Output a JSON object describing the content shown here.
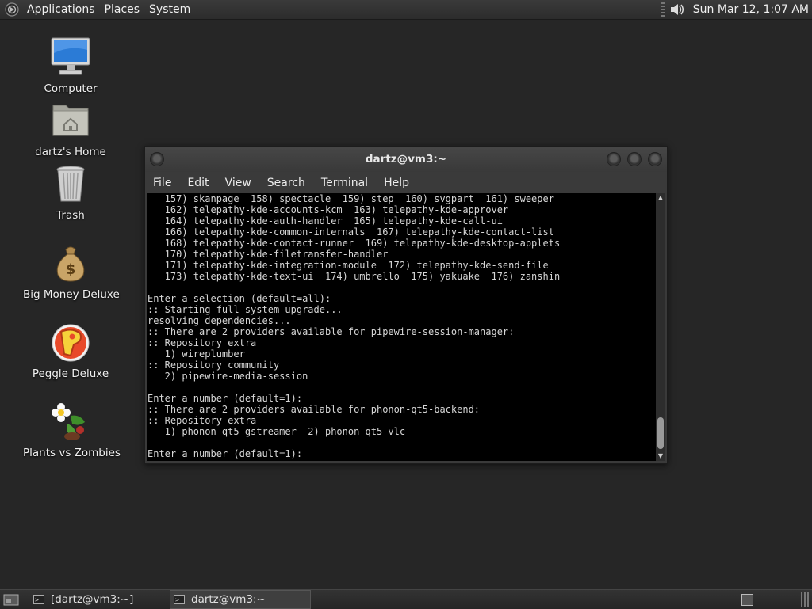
{
  "top_panel": {
    "menus": [
      "Applications",
      "Places",
      "System"
    ],
    "clock": "Sun Mar 12,  1:07 AM",
    "icons": {
      "menu": "distro-logo-icon",
      "volume": "speaker-volume-icon"
    }
  },
  "desktop_icons": [
    {
      "label": "Computer",
      "icon": "computer-monitor-icon"
    },
    {
      "label": "dartz's Home",
      "icon": "home-folder-icon"
    },
    {
      "label": "Trash",
      "icon": "trash-can-icon"
    },
    {
      "label": "Big Money Deluxe",
      "icon": "money-bag-icon"
    },
    {
      "label": "Peggle Deluxe",
      "icon": "peggle-p-icon"
    },
    {
      "label": "Plants vs Zombies",
      "icon": "plants-flower-icon"
    }
  ],
  "terminal_window": {
    "title": "dartz@vm3:~",
    "menus": [
      "File",
      "Edit",
      "View",
      "Search",
      "Terminal",
      "Help"
    ],
    "lines": [
      "   157) skanpage  158) spectacle  159) step  160) svgpart  161) sweeper",
      "   162) telepathy-kde-accounts-kcm  163) telepathy-kde-approver",
      "   164) telepathy-kde-auth-handler  165) telepathy-kde-call-ui",
      "   166) telepathy-kde-common-internals  167) telepathy-kde-contact-list",
      "   168) telepathy-kde-contact-runner  169) telepathy-kde-desktop-applets",
      "   170) telepathy-kde-filetransfer-handler",
      "   171) telepathy-kde-integration-module  172) telepathy-kde-send-file",
      "   173) telepathy-kde-text-ui  174) umbrello  175) yakuake  176) zanshin",
      "",
      "Enter a selection (default=all):",
      ":: Starting full system upgrade...",
      "resolving dependencies...",
      ":: There are 2 providers available for pipewire-session-manager:",
      ":: Repository extra",
      "   1) wireplumber",
      ":: Repository community",
      "   2) pipewire-media-session",
      "",
      "Enter a number (default=1):",
      ":: There are 2 providers available for phonon-qt5-backend:",
      ":: Repository extra",
      "   1) phonon-qt5-gstreamer  2) phonon-qt5-vlc",
      "",
      "Enter a number (default=1):"
    ]
  },
  "bottom_panel": {
    "tasks": [
      "[dartz@vm3:~]",
      "dartz@vm3:~"
    ],
    "icons": {
      "show_desktop": "show-desktop-icon",
      "task": "terminal-icon"
    }
  }
}
